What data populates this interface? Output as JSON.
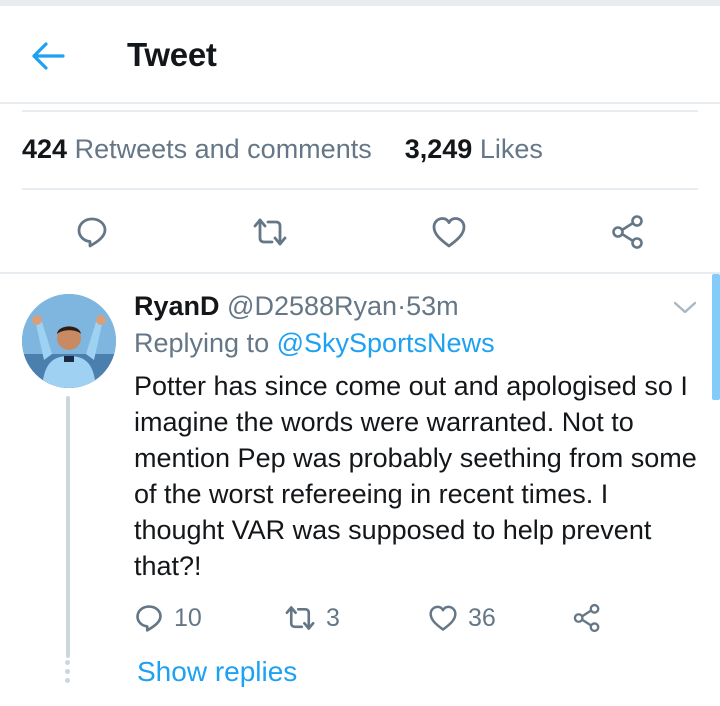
{
  "header": {
    "title": "Tweet"
  },
  "stats": {
    "retweets_count": "424",
    "retweets_label": "Retweets and comments",
    "likes_count": "3,249",
    "likes_label": "Likes"
  },
  "actions": [
    "reply-icon",
    "retweet-icon",
    "heart-icon",
    "share-icon"
  ],
  "reply": {
    "name": "RyanD",
    "handle": "@D2588Ryan",
    "separator": "·",
    "time": "53m",
    "replying_prefix": "Replying to",
    "replying_to": "@SkySportsNews",
    "text": "Potter has since come out and apologised so I imagine the words were warranted. Not to mention Pep was probably seething from some of the worst refereeing in recent times. I thought VAR was supposed to help prevent that?!",
    "reply_count": "10",
    "retweet_count": "3",
    "like_count": "36",
    "show_replies": "Show replies"
  },
  "colors": {
    "accent": "#1da1f2",
    "secondary_text": "#657786",
    "divider": "#e6ecf0"
  }
}
